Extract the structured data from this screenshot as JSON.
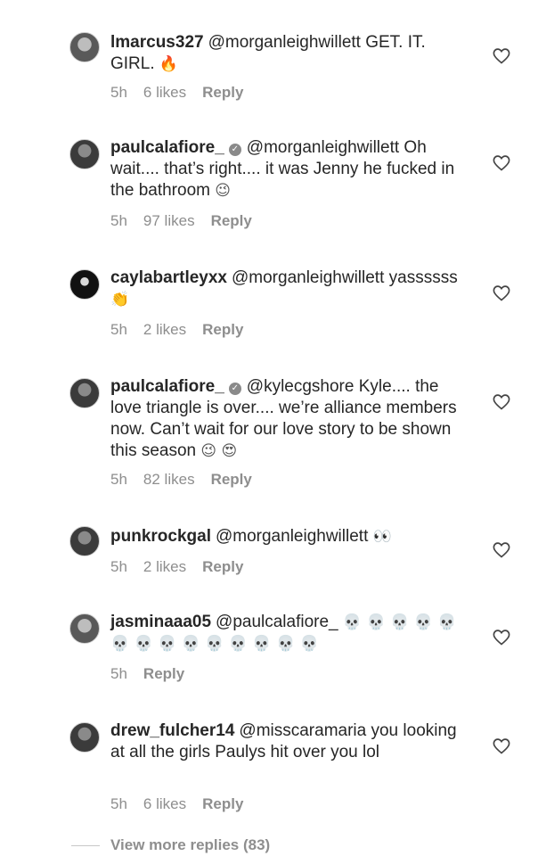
{
  "comments": [
    {
      "username": "lmarcus327",
      "verified": false,
      "text": "@morganleighwillett GET. IT. GIRL.",
      "emoji": "🔥",
      "time": "5h",
      "likes": "6 likes",
      "reply": "Reply"
    },
    {
      "username": "paulcalafiore_",
      "verified": true,
      "text": "@morganleighwillett Oh wait.... that’s right.... it was Jenny he fucked in the bathroom",
      "emoji": "😉",
      "time": "5h",
      "likes": "97 likes",
      "reply": "Reply"
    },
    {
      "username": "caylabartleyxx",
      "verified": false,
      "text": "@morganleighwillett yassssss",
      "emoji": "👏",
      "time": "5h",
      "likes": "2 likes",
      "reply": "Reply"
    },
    {
      "username": "paulcalafiore_",
      "verified": true,
      "text": "@kylecgshore Kyle.... the love triangle is over.... we’re alliance members now. Can’t wait for our love story to be shown this season",
      "emoji": "😉 😍",
      "time": "5h",
      "likes": "82 likes",
      "reply": "Reply"
    },
    {
      "username": "punkrockgal",
      "verified": false,
      "text": "@morganleighwillett",
      "emoji": "👀",
      "time": "5h",
      "likes": "2 likes",
      "reply": "Reply"
    },
    {
      "username": "jasminaaa05",
      "verified": false,
      "text": "@paulcalafiore_",
      "emoji": "💀 💀 💀 💀 💀 💀 💀 💀 💀 💀 💀 💀 💀 💀",
      "time": "5h",
      "likes": "",
      "reply": "Reply"
    },
    {
      "username": "drew_fulcher14",
      "verified": false,
      "text": "@misscaramaria you looking at all the girls Paulys hit over you lol",
      "emoji": "",
      "time": "5h",
      "likes": "6 likes",
      "reply": "Reply"
    }
  ],
  "view_more": "View more replies (83)",
  "icons": {
    "heart": "heart-icon",
    "verified": "verified-badge-icon"
  },
  "colors": {
    "text": "#262626",
    "muted": "#8e8e8e"
  }
}
